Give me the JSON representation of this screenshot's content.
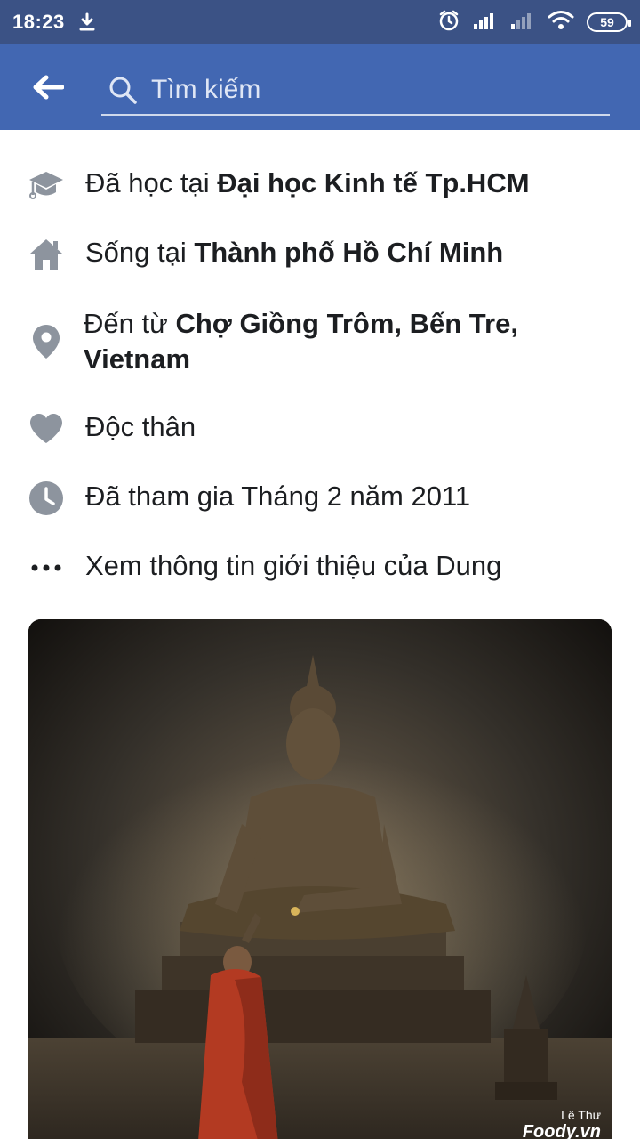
{
  "status_bar": {
    "time": "18:23",
    "battery": "59",
    "icons": [
      "download-icon",
      "alarm-icon",
      "signal-icon",
      "signal-weak-icon",
      "wifi-icon",
      "battery-icon"
    ]
  },
  "header": {
    "search_placeholder": "Tìm kiếm",
    "back_icon": "back-arrow-icon",
    "search_icon": "search-icon"
  },
  "intro": {
    "items": [
      {
        "icon": "education-icon",
        "prefix": "Đã học tại ",
        "bold": "Đại học Kinh tế Tp.HCM"
      },
      {
        "icon": "home-icon",
        "prefix": "Sống tại ",
        "bold": "Thành phố Hồ Chí Minh"
      },
      {
        "icon": "location-pin-icon",
        "prefix": "Đến từ ",
        "bold": "Chợ Giồng Trôm, Bến Tre, Vietnam"
      },
      {
        "icon": "heart-icon",
        "prefix": "Độc thân",
        "bold": ""
      },
      {
        "icon": "clock-icon",
        "prefix": "Đã tham gia Tháng 2 năm 2011",
        "bold": ""
      },
      {
        "icon": "more-dots-icon",
        "prefix": "Xem thông tin giới thiệu của Dung",
        "bold": ""
      }
    ]
  },
  "photo": {
    "user_label": "Lê Thư",
    "brand_label": "Foody.vn",
    "colors": {
      "background": "#1a1714",
      "robe": "#b33a22",
      "statue": "#5a4a36"
    }
  },
  "colors": {
    "status_bar": "#3b5285",
    "header": "#4267b2",
    "icon_gray": "#8d949e",
    "text": "#1c1e21"
  }
}
